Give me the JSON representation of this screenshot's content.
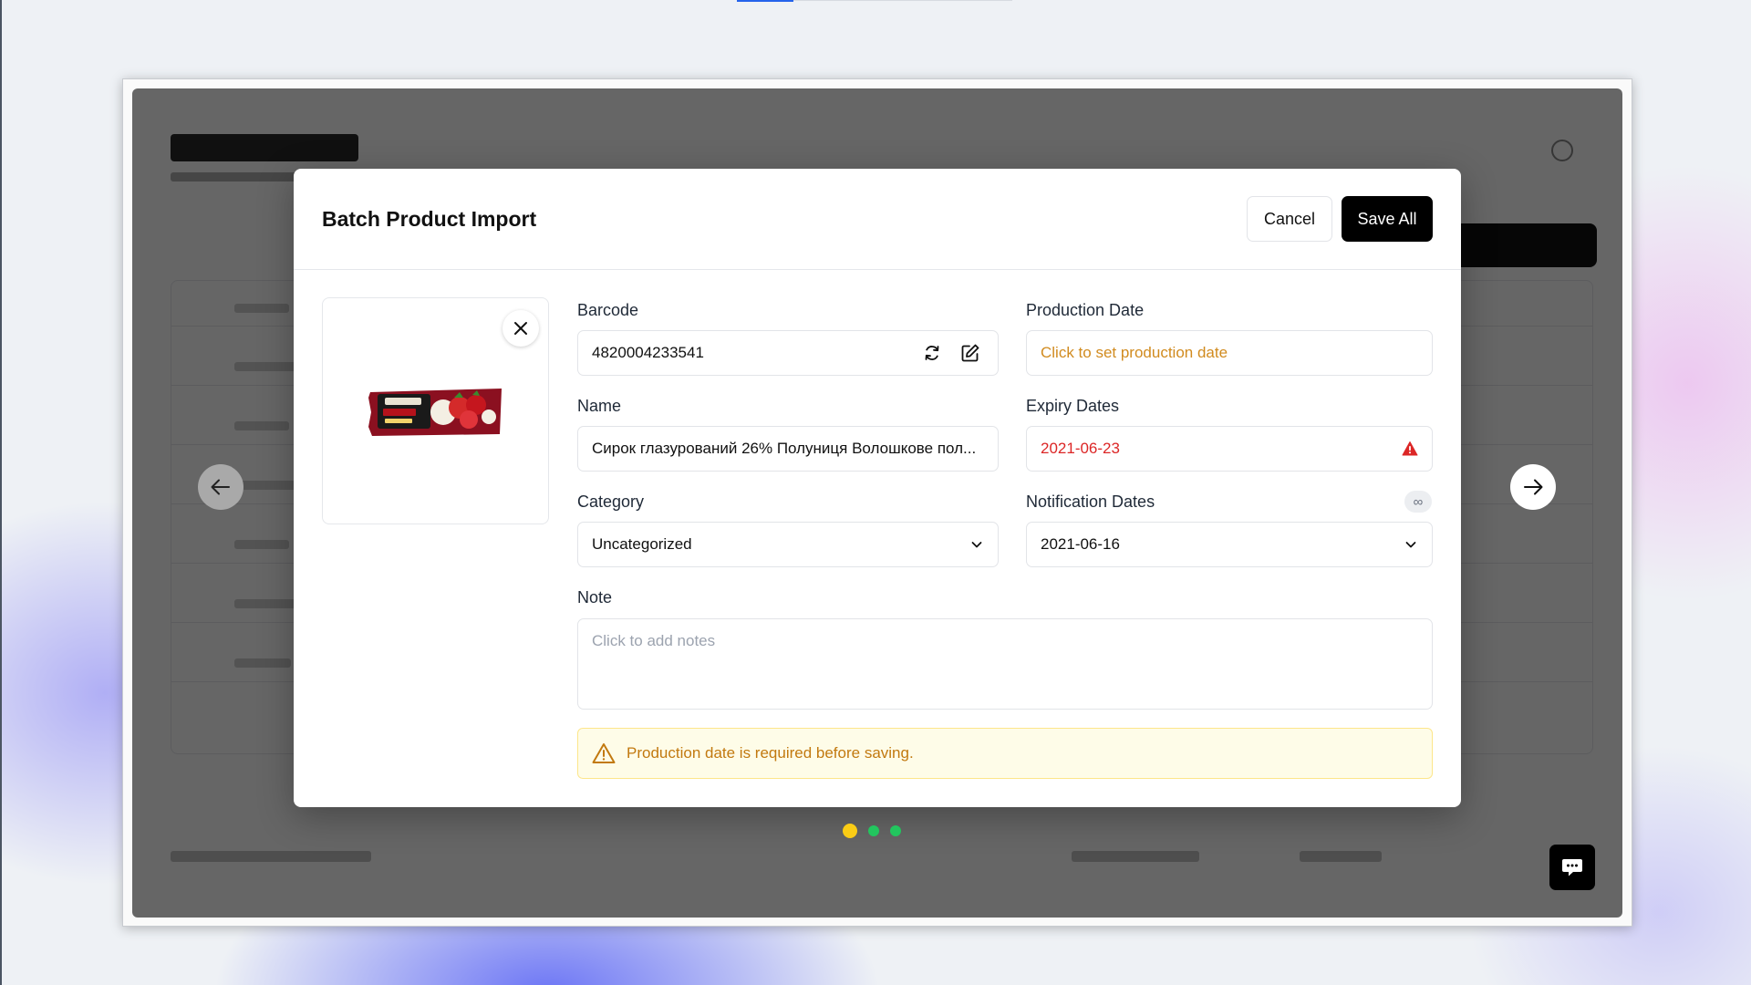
{
  "modal": {
    "title": "Batch Product Import",
    "cancel_label": "Cancel",
    "save_label": "Save All"
  },
  "product_image": {
    "icon": "product-photo"
  },
  "fields": {
    "barcode": {
      "label": "Barcode",
      "value": "4820004233541"
    },
    "name": {
      "label": "Name",
      "value": "Сирок глазурований 26% Полуниця Волошкове пол..."
    },
    "category": {
      "label": "Category",
      "value": "Uncategorized"
    },
    "production_date": {
      "label": "Production Date",
      "placeholder": "Click to set production date"
    },
    "expiry_dates": {
      "label": "Expiry Dates",
      "value": "2021-06-23",
      "status": "error"
    },
    "notification_dates": {
      "label": "Notification Dates",
      "value": "2021-06-16",
      "badge": "∞"
    },
    "note": {
      "label": "Note",
      "placeholder": "Click to add notes"
    }
  },
  "warning": {
    "text": "Production date is required before saving."
  },
  "pagination": {
    "total": 3,
    "current": 1,
    "states": [
      "current",
      "ready",
      "ready"
    ]
  },
  "colors": {
    "warning": "#d18b1f",
    "error": "#dc2626",
    "dot_current": "#facc15",
    "dot_ready": "#22c55e",
    "primary": "#000000"
  }
}
